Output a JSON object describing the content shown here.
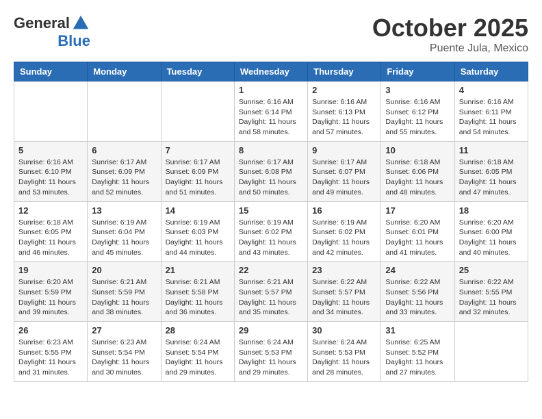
{
  "header": {
    "logo_line1": "General",
    "logo_line2": "Blue",
    "month": "October 2025",
    "location": "Puente Jula, Mexico"
  },
  "days_of_week": [
    "Sunday",
    "Monday",
    "Tuesday",
    "Wednesday",
    "Thursday",
    "Friday",
    "Saturday"
  ],
  "weeks": [
    [
      {
        "day": "",
        "info": ""
      },
      {
        "day": "",
        "info": ""
      },
      {
        "day": "",
        "info": ""
      },
      {
        "day": "1",
        "info": "Sunrise: 6:16 AM\nSunset: 6:14 PM\nDaylight: 11 hours\nand 58 minutes."
      },
      {
        "day": "2",
        "info": "Sunrise: 6:16 AM\nSunset: 6:13 PM\nDaylight: 11 hours\nand 57 minutes."
      },
      {
        "day": "3",
        "info": "Sunrise: 6:16 AM\nSunset: 6:12 PM\nDaylight: 11 hours\nand 55 minutes."
      },
      {
        "day": "4",
        "info": "Sunrise: 6:16 AM\nSunset: 6:11 PM\nDaylight: 11 hours\nand 54 minutes."
      }
    ],
    [
      {
        "day": "5",
        "info": "Sunrise: 6:16 AM\nSunset: 6:10 PM\nDaylight: 11 hours\nand 53 minutes."
      },
      {
        "day": "6",
        "info": "Sunrise: 6:17 AM\nSunset: 6:09 PM\nDaylight: 11 hours\nand 52 minutes."
      },
      {
        "day": "7",
        "info": "Sunrise: 6:17 AM\nSunset: 6:09 PM\nDaylight: 11 hours\nand 51 minutes."
      },
      {
        "day": "8",
        "info": "Sunrise: 6:17 AM\nSunset: 6:08 PM\nDaylight: 11 hours\nand 50 minutes."
      },
      {
        "day": "9",
        "info": "Sunrise: 6:17 AM\nSunset: 6:07 PM\nDaylight: 11 hours\nand 49 minutes."
      },
      {
        "day": "10",
        "info": "Sunrise: 6:18 AM\nSunset: 6:06 PM\nDaylight: 11 hours\nand 48 minutes."
      },
      {
        "day": "11",
        "info": "Sunrise: 6:18 AM\nSunset: 6:05 PM\nDaylight: 11 hours\nand 47 minutes."
      }
    ],
    [
      {
        "day": "12",
        "info": "Sunrise: 6:18 AM\nSunset: 6:05 PM\nDaylight: 11 hours\nand 46 minutes."
      },
      {
        "day": "13",
        "info": "Sunrise: 6:19 AM\nSunset: 6:04 PM\nDaylight: 11 hours\nand 45 minutes."
      },
      {
        "day": "14",
        "info": "Sunrise: 6:19 AM\nSunset: 6:03 PM\nDaylight: 11 hours\nand 44 minutes."
      },
      {
        "day": "15",
        "info": "Sunrise: 6:19 AM\nSunset: 6:02 PM\nDaylight: 11 hours\nand 43 minutes."
      },
      {
        "day": "16",
        "info": "Sunrise: 6:19 AM\nSunset: 6:02 PM\nDaylight: 11 hours\nand 42 minutes."
      },
      {
        "day": "17",
        "info": "Sunrise: 6:20 AM\nSunset: 6:01 PM\nDaylight: 11 hours\nand 41 minutes."
      },
      {
        "day": "18",
        "info": "Sunrise: 6:20 AM\nSunset: 6:00 PM\nDaylight: 11 hours\nand 40 minutes."
      }
    ],
    [
      {
        "day": "19",
        "info": "Sunrise: 6:20 AM\nSunset: 5:59 PM\nDaylight: 11 hours\nand 39 minutes."
      },
      {
        "day": "20",
        "info": "Sunrise: 6:21 AM\nSunset: 5:59 PM\nDaylight: 11 hours\nand 38 minutes."
      },
      {
        "day": "21",
        "info": "Sunrise: 6:21 AM\nSunset: 5:58 PM\nDaylight: 11 hours\nand 36 minutes."
      },
      {
        "day": "22",
        "info": "Sunrise: 6:21 AM\nSunset: 5:57 PM\nDaylight: 11 hours\nand 35 minutes."
      },
      {
        "day": "23",
        "info": "Sunrise: 6:22 AM\nSunset: 5:57 PM\nDaylight: 11 hours\nand 34 minutes."
      },
      {
        "day": "24",
        "info": "Sunrise: 6:22 AM\nSunset: 5:56 PM\nDaylight: 11 hours\nand 33 minutes."
      },
      {
        "day": "25",
        "info": "Sunrise: 6:22 AM\nSunset: 5:55 PM\nDaylight: 11 hours\nand 32 minutes."
      }
    ],
    [
      {
        "day": "26",
        "info": "Sunrise: 6:23 AM\nSunset: 5:55 PM\nDaylight: 11 hours\nand 31 minutes."
      },
      {
        "day": "27",
        "info": "Sunrise: 6:23 AM\nSunset: 5:54 PM\nDaylight: 11 hours\nand 30 minutes."
      },
      {
        "day": "28",
        "info": "Sunrise: 6:24 AM\nSunset: 5:54 PM\nDaylight: 11 hours\nand 29 minutes."
      },
      {
        "day": "29",
        "info": "Sunrise: 6:24 AM\nSunset: 5:53 PM\nDaylight: 11 hours\nand 29 minutes."
      },
      {
        "day": "30",
        "info": "Sunrise: 6:24 AM\nSunset: 5:53 PM\nDaylight: 11 hours\nand 28 minutes."
      },
      {
        "day": "31",
        "info": "Sunrise: 6:25 AM\nSunset: 5:52 PM\nDaylight: 11 hours\nand 27 minutes."
      },
      {
        "day": "",
        "info": ""
      }
    ]
  ]
}
